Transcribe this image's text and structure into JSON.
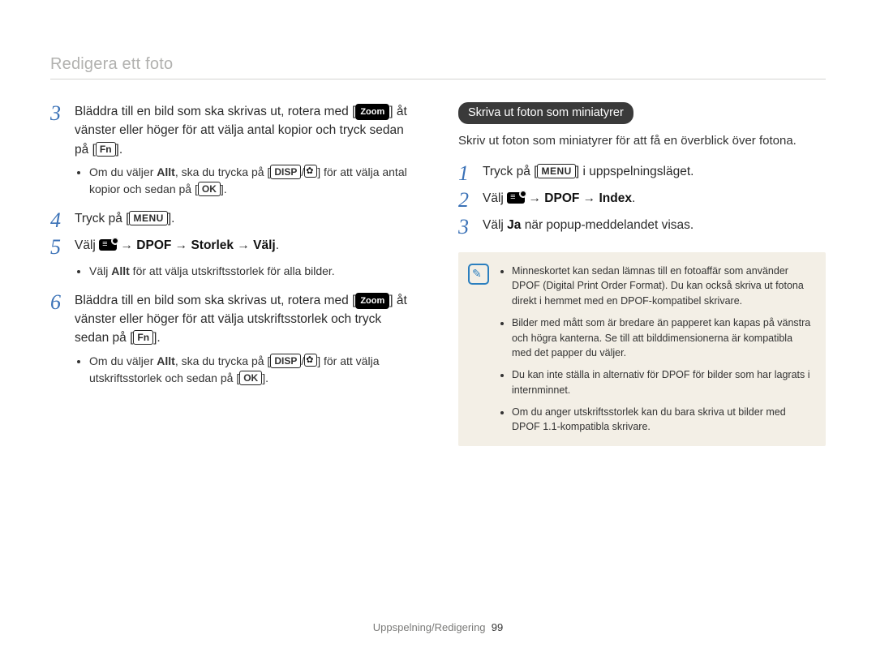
{
  "header": {
    "title": "Redigera ett foto"
  },
  "left": {
    "step3": {
      "num": "3",
      "l1a": "Bläddra till en bild som ska skrivas ut, rotera med ",
      "l1b": " åt vänster eller höger för att välja antal kopior och tryck sedan på ",
      "zoom_key": "Zoom",
      "fn_key": "Fn",
      "period": ".",
      "bullet_a1": "Om du väljer ",
      "bullet_allt": "Allt",
      "bullet_a2": ", ska du trycka på ",
      "disp_key": "DISP",
      "slash": "/",
      "bullet_a3": " för att välja antal kopior och sedan på ",
      "ok_key": "OK",
      "bullet_end": "."
    },
    "step4": {
      "num": "4",
      "text_a": "Tryck på ",
      "menu_key": "MENU",
      "text_b": "."
    },
    "step5": {
      "num": "5",
      "text_a": "Välj ",
      "arrow": " → ",
      "dpof": "DPOF",
      "storlek": "Storlek",
      "valj": "Välj",
      "period": ".",
      "bullet_a1": "Välj ",
      "bullet_allt": "Allt",
      "bullet_a2": " för att välja utskriftsstorlek för alla bilder."
    },
    "step6": {
      "num": "6",
      "l1a": "Bläddra till en bild som ska skrivas ut, rotera med ",
      "l1b": " åt vänster eller höger för att välja utskriftsstorlek och tryck sedan på ",
      "zoom_key": "Zoom",
      "fn_key": "Fn",
      "period": ".",
      "bullet_a1": "Om du väljer ",
      "bullet_allt": "Allt",
      "bullet_a2": ", ska du trycka på ",
      "disp_key": "DISP",
      "slash": "/",
      "bullet_a3": " för att välja utskriftsstorlek och sedan på ",
      "ok_key": "OK",
      "bullet_end": "."
    }
  },
  "right": {
    "pill": "Skriva ut foton som miniatyrer",
    "intro": "Skriv ut foton som miniatyrer för att få en överblick över fotona.",
    "step1": {
      "num": "1",
      "text_a": "Tryck på ",
      "menu_key": "MENU",
      "text_b": " i uppspelningsläget."
    },
    "step2": {
      "num": "2",
      "text_a": "Välj ",
      "arrow": " → ",
      "dpof": "DPOF",
      "index": "Index",
      "period": "."
    },
    "step3": {
      "num": "3",
      "text_a": "Välj ",
      "ja": "Ja",
      "text_b": " när popup-meddelandet visas."
    },
    "notes": {
      "n1": "Minneskortet kan sedan lämnas till en fotoaffär som använder DPOF (Digital Print Order Format). Du kan också skriva ut fotona direkt i hemmet med en DPOF-kompatibel skrivare.",
      "n2": "Bilder med mått som är bredare än papperet kan kapas på vänstra och högra kanterna. Se till att bilddimensionerna är kompatibla med det papper du väljer.",
      "n3": "Du kan inte ställa in alternativ för DPOF för bilder som har lagrats i internminnet.",
      "n4": "Om du anger utskriftsstorlek kan du bara skriva ut bilder med DPOF 1.1-kompatibla skrivare."
    }
  },
  "footer": {
    "section": "Uppspelning/Redigering",
    "page": "99"
  }
}
